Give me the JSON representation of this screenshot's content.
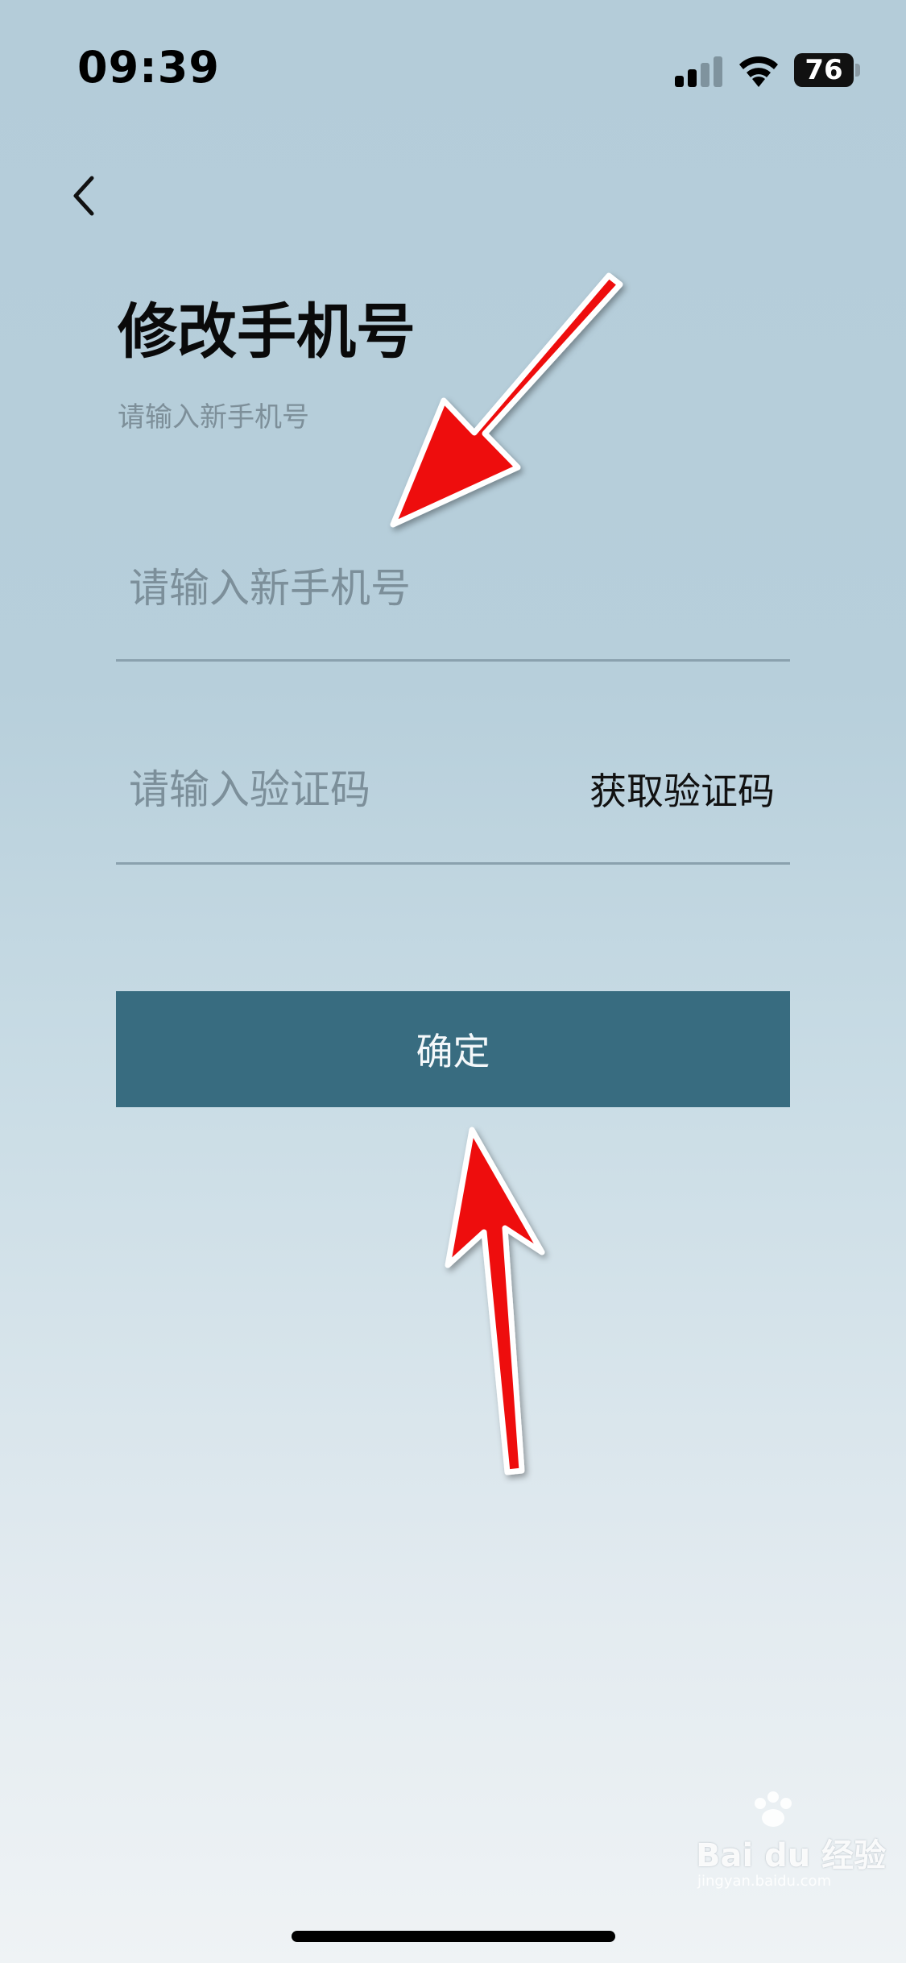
{
  "status_bar": {
    "time": "09:39",
    "battery": "76",
    "icons": [
      "signal-icon",
      "wifi-icon",
      "battery-icon"
    ]
  },
  "nav": {
    "back_icon": "chevron-left-icon"
  },
  "header": {
    "title": "修改手机号",
    "subtitle": "请输入新手机号"
  },
  "form": {
    "phone_placeholder": "请输入新手机号",
    "phone_value": "",
    "code_placeholder": "请输入验证码",
    "code_value": "",
    "get_code_label": "获取验证码",
    "confirm_label": "确定"
  },
  "watermark": {
    "brand": "Bai du 经验",
    "url": "jingyan.baidu.com"
  },
  "colors": {
    "background_top": "#b4ccd9",
    "background_bottom": "#eff3f5",
    "button": "#386c80",
    "annotation_arrow": "#ee1111",
    "divider": "#8aa1ae"
  }
}
